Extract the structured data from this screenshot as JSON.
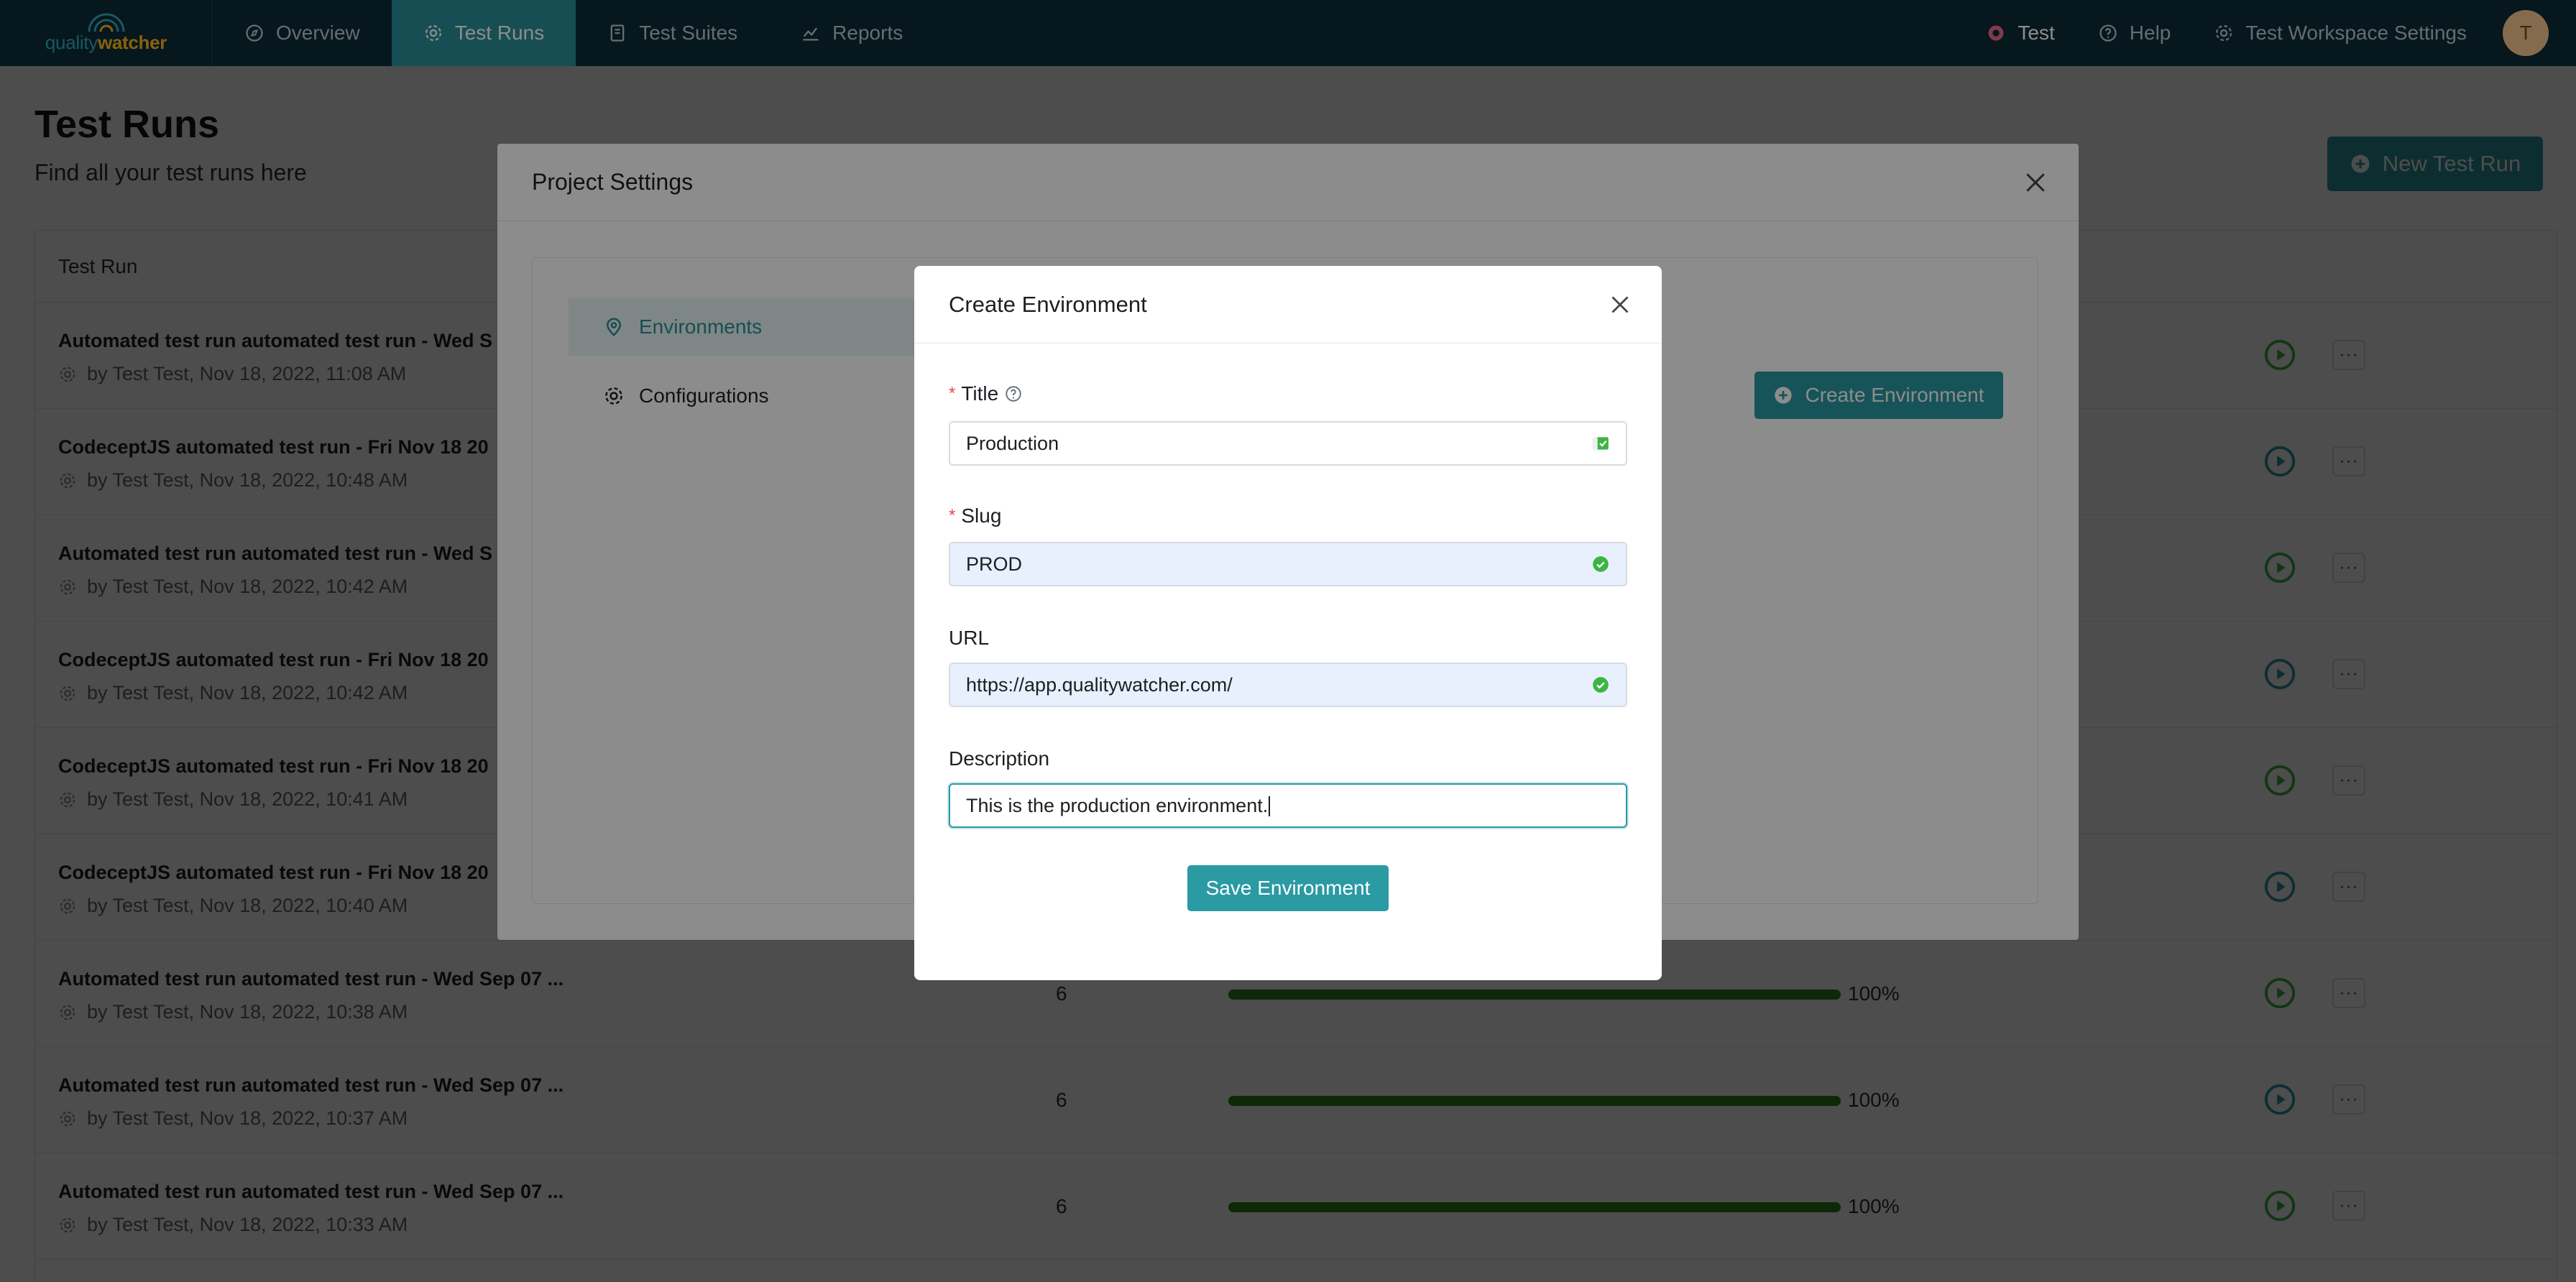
{
  "nav": {
    "logo_q": "quality",
    "logo_w": "watcher",
    "items": [
      {
        "label": "Overview",
        "icon": "compass-icon"
      },
      {
        "label": "Test Runs",
        "icon": "gear-icon",
        "active": true
      },
      {
        "label": "Test Suites",
        "icon": "book-icon"
      },
      {
        "label": "Reports",
        "icon": "chart-icon"
      }
    ],
    "project": "Test",
    "help": "Help",
    "workspace_settings": "Test Workspace Settings",
    "avatar_initial": "T",
    "accent_color": "#2a8f98",
    "nav_bg": "#0b2b36"
  },
  "page": {
    "title": "Test Runs",
    "subtitle": "Find all your test runs here",
    "new_run_button": "New Test Run",
    "table_header": "Test Run"
  },
  "rows": [
    {
      "title": "Automated test run automated test run - Wed S",
      "meta": "by Test Test, Nov 18, 2022, 11:08 AM"
    },
    {
      "title": "CodeceptJS automated test run - Fri Nov 18 20",
      "meta": "by Test Test, Nov 18, 2022, 10:48 AM"
    },
    {
      "title": "Automated test run automated test run - Wed S",
      "meta": "by Test Test, Nov 18, 2022, 10:42 AM"
    },
    {
      "title": "CodeceptJS automated test run - Fri Nov 18 20",
      "meta": "by Test Test, Nov 18, 2022, 10:42 AM"
    },
    {
      "title": "CodeceptJS automated test run - Fri Nov 18 20",
      "meta": "by Test Test, Nov 18, 2022, 10:41 AM"
    },
    {
      "title": "CodeceptJS automated test run - Fri Nov 18 20",
      "meta": "by Test Test, Nov 18, 2022, 10:40 AM"
    },
    {
      "title": "Automated test run automated test run - Wed Sep 07 ...",
      "meta": "by Test Test, Nov 18, 2022, 10:38 AM",
      "count": "6",
      "pct": "100%"
    },
    {
      "title": "Automated test run automated test run - Wed Sep 07 ...",
      "meta": "by Test Test, Nov 18, 2022, 10:37 AM",
      "count": "6",
      "pct": "100%"
    },
    {
      "title": "Automated test run automated test run - Wed Sep 07 ...",
      "meta": "by Test Test, Nov 18, 2022, 10:33 AM",
      "count": "6",
      "pct": "100%"
    }
  ],
  "project_settings": {
    "title": "Project Settings",
    "tabs": [
      {
        "label": "Environments",
        "active": true
      },
      {
        "label": "Configurations"
      }
    ],
    "create_button": "Create Environment"
  },
  "create_env": {
    "title": "Create Environment",
    "fields": {
      "title": {
        "label": "Title",
        "value": "Production",
        "required": true
      },
      "slug": {
        "label": "Slug",
        "value": "PROD",
        "required": true
      },
      "url": {
        "label": "URL",
        "value": "https://app.qualitywatcher.com/"
      },
      "description": {
        "label": "Description",
        "value": "This is the production environment."
      }
    },
    "save_button": "Save Environment"
  }
}
